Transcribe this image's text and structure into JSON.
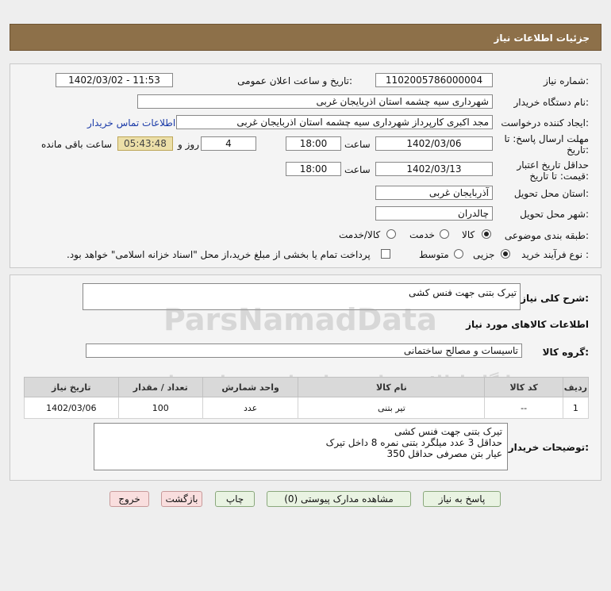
{
  "header": {
    "title": "جزئیات اطلاعات نیاز"
  },
  "form": {
    "need_number": {
      "label": "شماره نیاز:",
      "value": "1102005786000004"
    },
    "announce": {
      "label": "تاریخ و ساعت اعلان عمومی:",
      "value": "1402/03/02 - 11:53"
    },
    "buyer_org": {
      "label": "نام دستگاه خریدار:",
      "value": "شهرداری سیه چشمه استان اذربایجان غربی"
    },
    "requester": {
      "label": "ایجاد کننده درخواست:",
      "value": "مجد اکبری کارپرداز شهرداری سیه چشمه استان اذربایجان غربی"
    },
    "contact_link": "اطلاعات تماس خریدار",
    "deadline": {
      "label_line1": "مهلت ارسال پاسخ: تا",
      "label_line2": "تاریخ:",
      "date": "1402/03/06",
      "time_label": "ساعت",
      "time": "18:00",
      "days": "4",
      "days_label": "روز و",
      "remaining": "05:43:48",
      "remaining_label": "ساعت باقی مانده"
    },
    "validity": {
      "label_line1": "حداقل تاریخ اعتبار",
      "label_line2": "قیمت: تا تاریخ:",
      "date": "1402/03/13",
      "time_label": "ساعت",
      "time": "18:00"
    },
    "province": {
      "label": "استان محل تحویل:",
      "value": "آذربایجان غربی"
    },
    "city": {
      "label": "شهر محل تحویل:",
      "value": "چالدران"
    },
    "category": {
      "label": "طبقه بندی موضوعی:",
      "options": [
        "کالا",
        "خدمت",
        "کالا/خدمت"
      ],
      "selected": "کالا"
    },
    "process": {
      "label": "نوع فرآیند خرید :",
      "options": [
        "جزیی",
        "متوسط"
      ],
      "selected": "جزیی",
      "treasury_note": "پرداخت تمام یا بخشی از مبلغ خرید،از محل \"اسناد خزانه اسلامی\" خواهد بود."
    }
  },
  "summary": {
    "label": "شرح کلی نیاز:",
    "value": "تیرک بتنی جهت فنس کشی"
  },
  "goods": {
    "section_title": "اطلاعات کالاهای مورد نیاز",
    "group_label": "گروه کالا:",
    "group_value": "تاسیسات و مصالح ساختمانی",
    "columns": [
      "ردیف",
      "کد کالا",
      "نام کالا",
      "واحد شمارش",
      "تعداد / مقدار",
      "تاریخ نیاز"
    ],
    "rows": [
      [
        "1",
        "--",
        "تیر بتنی",
        "عدد",
        "100",
        "1402/03/06"
      ]
    ]
  },
  "buyer_notes": {
    "label": "توضیحات خریدار:",
    "lines": [
      "تیرک بتنی جهت فنس کشی",
      "حداقل 3 عدد میلگرد بتنی نمره 8 داخل تیرک",
      "عیار بتن مصرفی حداقل 350"
    ]
  },
  "buttons": {
    "reply": "پاسخ به نیاز",
    "attachments": "مشاهده مدارک پیوستی (0)",
    "print": "چاپ",
    "back": "بازگشت",
    "exit": "خروج"
  },
  "watermark": {
    "brand": "ParsNamadData",
    "line1": "پایگاه اطلاع رسانی مناقصات و مزایده ها",
    "phone": "۰۲۱-۸۸۳۴۹۶۷۰-۵"
  }
}
